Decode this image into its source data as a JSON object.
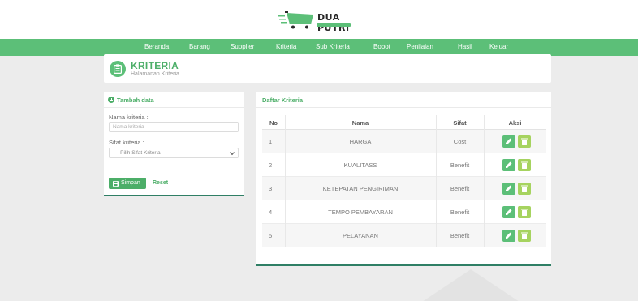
{
  "brand": {
    "name": "DUA PUTRI"
  },
  "nav": {
    "items": [
      {
        "label": "Beranda"
      },
      {
        "label": "Barang"
      },
      {
        "label": "Supplier"
      },
      {
        "label": "Kriteria"
      },
      {
        "label": "Sub Kriteria"
      },
      {
        "label": "Bobot"
      },
      {
        "label": "Penilaian"
      },
      {
        "label": "Hasil"
      },
      {
        "label": "Keluar"
      }
    ]
  },
  "header": {
    "title": "KRITERIA",
    "subtitle": "Halamanan Kriteria",
    "icon": "clipboard-icon"
  },
  "form": {
    "title": "Tambah data",
    "name_label": "Nama kriteria :",
    "name_placeholder": "Nama kriteria",
    "sifat_label": "Sifat kriteria :",
    "sifat_selected": "-- Pilih Sifat Kriteria --",
    "save_label": "Simpan",
    "reset_label": "Reset"
  },
  "list": {
    "title": "Daftar Kriteria",
    "columns": [
      "No",
      "Nama",
      "Sifat",
      "Aksi"
    ],
    "rows": [
      {
        "no": "1",
        "nama": "HARGA",
        "sifat": "Cost"
      },
      {
        "no": "2",
        "nama": "KUALITASS",
        "sifat": "Benefit"
      },
      {
        "no": "3",
        "nama": "KETEPATAN PENGIRIMAN",
        "sifat": "Benefit"
      },
      {
        "no": "4",
        "nama": "TEMPO PEMBAYARAN",
        "sifat": "Benefit"
      },
      {
        "no": "5",
        "nama": "PELAYANAN",
        "sifat": "Benefit"
      }
    ]
  },
  "colors": {
    "primary": "#5cbf78",
    "accent_dark": "#2f7f65",
    "delete": "#a6d35f"
  }
}
